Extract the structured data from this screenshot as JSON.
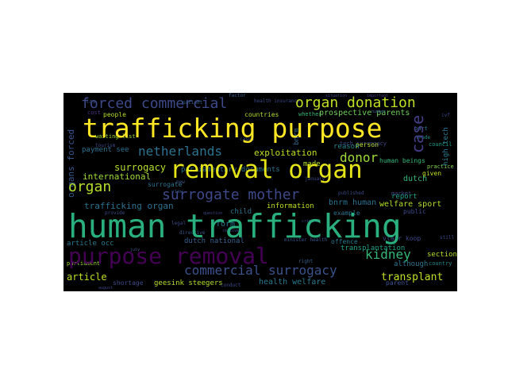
{
  "words": {
    "human_trafficking": "human trafficking",
    "trafficking_purpose": "trafficking purpose",
    "removal_organ": "removal organ",
    "purpose_removal": "purpose removal",
    "forced_commercial": "forced commercial",
    "organ_donation": "organ donation",
    "commercial_surrogacy": "commercial surrogacy",
    "surrogate_mother": "surrogate mother",
    "netherlands": "netherlands",
    "organ": "organ",
    "case": "case",
    "donor": "donor",
    "kidney": "kidney",
    "transplant": "transplant",
    "article": "article",
    "exploitation": "exploitation",
    "surrogacy": "surrogacy",
    "organs_forced": "organs forced",
    "international": "international",
    "trafficking_organ": "trafficking organ",
    "payment_see": "payment see",
    "waiting_list": "waiting list",
    "parliamentary_documents": "parliamentary documents",
    "prospective_parents": "prospective parents",
    "countries": "countries",
    "people": "people",
    "cost": "cost",
    "las": "las",
    "bnrm_human": "bnrm human",
    "welfare_sport": "welfare sport",
    "human_beings": "human beings",
    "information": "information",
    "child": "child",
    "form": "form",
    "made": "made",
    "dutch": "dutch",
    "reason": "reason",
    "person": "person",
    "example": "example",
    "public": "public",
    "report": "report",
    "section": "section",
    "although": "although",
    "transplantation": "transplantation",
    "offence": "offence",
    "high_tech": "high tech",
    "dutch_national": "dutch national",
    "article_occ": "article occ",
    "health_welfare": "health welfare",
    "geesink_steegers": "geesink steegers",
    "shortage": "shortage",
    "surrogate": "surrogate",
    "market": "market",
    "given": "given",
    "practice": "practice",
    "country": "country",
    "council": "council",
    "parent": "parent",
    "parliament": "parliament",
    "whether": "whether",
    "bnrm": "bnrm",
    "part": "part",
    "trade": "trade",
    "patient": "patient",
    "tourism": "tourism",
    "vlaar_koop": "vlaar koop",
    "provide": "provide",
    "tech_surrogacy": "tech surrogacy",
    "new": "new",
    "view": "view",
    "conduct": "conduct",
    "health_insurance": "health insurance",
    "minister_health": "minister health",
    "directive": "directive",
    "important": "important",
    "published": "published",
    "situation": "situation",
    "factor": "factor",
    "january": "january",
    "legal": "legal",
    "question": "question",
    "receive": "receive",
    "july": "july",
    "cases": "cases",
    "august": "august",
    "still": "still",
    "number": "number",
    "ivf": "ivf",
    "right": "right",
    "criminal": "criminal"
  }
}
